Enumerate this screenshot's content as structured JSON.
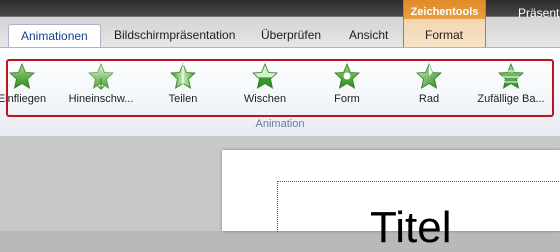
{
  "window": {
    "title_fragment": "Präsent"
  },
  "context_tab_group": {
    "label": "Zeichentools"
  },
  "tabs": [
    {
      "label": "Animationen",
      "active": true
    },
    {
      "label": "Bildschirmpräsentation",
      "active": false
    },
    {
      "label": "Überprüfen",
      "active": false
    },
    {
      "label": "Ansicht",
      "active": false
    },
    {
      "label": "Format",
      "active": false
    }
  ],
  "ribbon": {
    "group_label": "Animation",
    "gallery": [
      {
        "label": "Einfliegen",
        "icon": "star-fly-in-icon"
      },
      {
        "label": "Hineinschw...",
        "icon": "star-float-in-icon"
      },
      {
        "label": "Teilen",
        "icon": "star-split-icon"
      },
      {
        "label": "Wischen",
        "icon": "star-wipe-icon"
      },
      {
        "label": "Form",
        "icon": "star-shape-icon"
      },
      {
        "label": "Rad",
        "icon": "star-wheel-icon"
      },
      {
        "label": "Zufällige Ba...",
        "icon": "star-random-bars-icon"
      }
    ],
    "highlight_color": "#c0141b"
  },
  "slide": {
    "title_fragment": "Titel"
  },
  "colors": {
    "star_green": "#4caf3a",
    "context_orange": "#e08a26",
    "active_tab_text": "#15428b"
  }
}
